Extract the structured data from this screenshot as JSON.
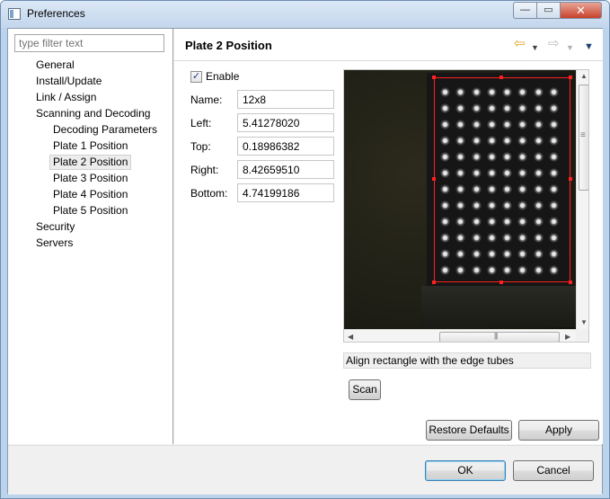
{
  "window": {
    "title": "Preferences",
    "controls": {
      "minimize": "—",
      "maximize": "▭",
      "close": "✕"
    }
  },
  "sidebar": {
    "filter_placeholder": "type filter text",
    "items": [
      {
        "label": "General",
        "level": 1
      },
      {
        "label": "Install/Update",
        "level": 1
      },
      {
        "label": "Link / Assign",
        "level": 1
      },
      {
        "label": "Scanning and Decoding",
        "level": 1
      },
      {
        "label": "Decoding Parameters",
        "level": 2
      },
      {
        "label": "Plate 1 Position",
        "level": 2
      },
      {
        "label": "Plate 2 Position",
        "level": 2,
        "selected": true
      },
      {
        "label": "Plate 3 Position",
        "level": 2
      },
      {
        "label": "Plate 4 Position",
        "level": 2
      },
      {
        "label": "Plate 5 Position",
        "level": 2
      },
      {
        "label": "Security",
        "level": 1
      },
      {
        "label": "Servers",
        "level": 1
      }
    ]
  },
  "page": {
    "title": "Plate 2 Position",
    "nav_icons": {
      "back": "⇦",
      "forward": "⇨",
      "dropdown": "▼"
    },
    "enable": {
      "label": "Enable",
      "checked": true,
      "check": "✓"
    },
    "fields": {
      "name": {
        "label": "Name:",
        "value": "12x8"
      },
      "left": {
        "label": "Left:",
        "value": "5.41278020"
      },
      "top": {
        "label": "Top:",
        "value": "0.18986382"
      },
      "right": {
        "label": "Right:",
        "value": "8.42659510"
      },
      "bottom": {
        "label": "Bottom:",
        "value": "4.74199186"
      }
    },
    "image_hint": "Align rectangle with the edge tubes",
    "scan_label": "Scan",
    "plate_grid": {
      "rows": 12,
      "cols": 8
    },
    "restore_defaults": "Restore Defaults",
    "apply": "Apply"
  },
  "footer": {
    "ok": "OK",
    "cancel": "Cancel"
  },
  "colors": {
    "alignment_rect": "#ff1f1f",
    "selection_bg": "#ededed",
    "back_arrow": "#e4a01a"
  }
}
